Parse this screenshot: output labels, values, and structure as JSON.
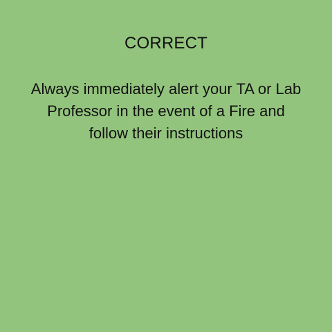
{
  "feedback": {
    "title": "CORRECT",
    "message_lines": [
      "Always immediately alert your TA or Lab",
      "Professor in the event of a Fire and",
      "follow their instructions"
    ]
  },
  "colors": {
    "background": "#93c47d",
    "text": "#111111"
  }
}
